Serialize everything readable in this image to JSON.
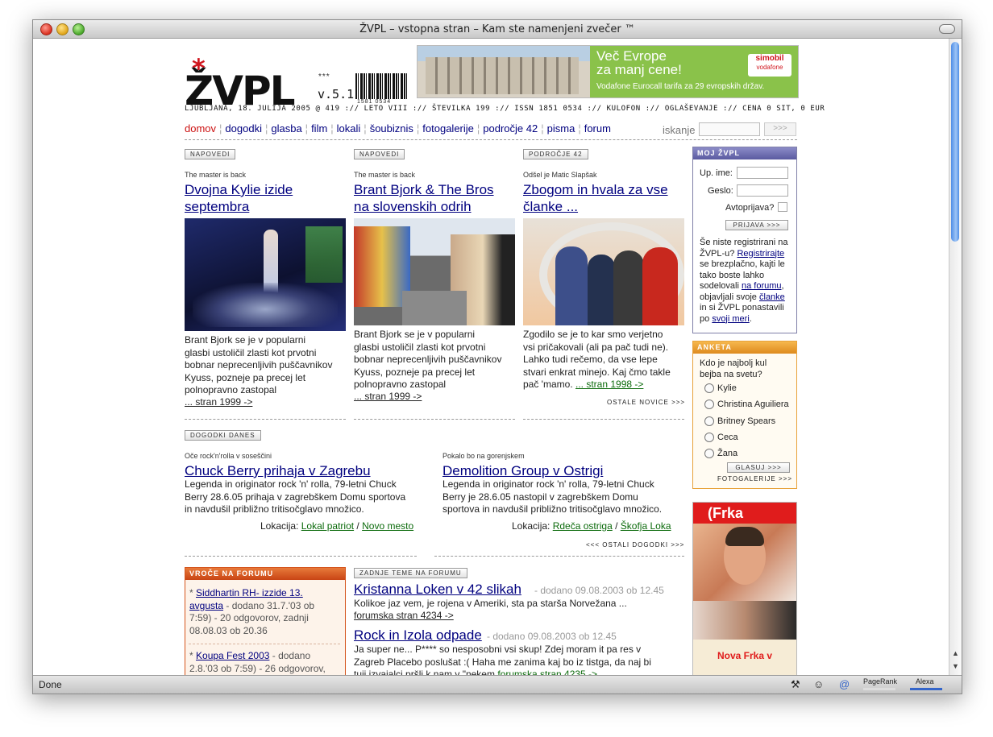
{
  "window": {
    "title": "ŽVPL – vstopna stran – Kam ste namenjeni zvečer ™"
  },
  "status": {
    "text": "Done",
    "pagerank": "PageRank",
    "alexa": "Alexa"
  },
  "header": {
    "logo": "ŽVPL",
    "stars": "***",
    "version": "v.5.1",
    "barcode_number": "1581 0534",
    "dateline": "LJUBLJANA, 18. JULIJA 2005 @ 419 :// LETO VIII :// ŠTEVILKA 199 :// ISSN 1851 0534 :// KULOFON :// OGLAŠEVANJE :// CENA 0 SIT, 0 EUR",
    "banner": {
      "line1": "Več Evrope",
      "line2": "za manj cene!",
      "line3": "Vodafone Eurocall tarifa za 29 evropskih držav.",
      "brand": "simobil",
      "brand2": "vodafone"
    }
  },
  "nav": {
    "items": [
      "domov",
      "dogodki",
      "glasba",
      "film",
      "lokali",
      "šoubiznis",
      "fotogalerije",
      "področje 42",
      "pisma",
      "forum"
    ],
    "search_label": "iskanje",
    "search_button": ">>>"
  },
  "news": [
    {
      "tag": "NAPOVEDI",
      "kicker": "The master is back",
      "title_l1": "Dvojna Kylie izide",
      "title_l2": "septembra",
      "body": [
        "Brant Bjork se je v popularni",
        "glasbi ustoličil zlasti kot prvotni",
        "bobnar neprecenljivih puščavnikov",
        "Kyuss, pozneje pa precej let",
        "polnopravno zastopal"
      ],
      "more": "... stran 1999 ->"
    },
    {
      "tag": "NAPOVEDI",
      "kicker": "The master is back",
      "title_l1": "Brant Bjork & The Bros",
      "title_l2": "na slovenskih odrih",
      "body": [
        "Brant Bjork se je v popularni",
        "glasbi ustoličil zlasti kot prvotni",
        "bobnar neprecenljivih puščavnikov",
        "Kyuss, pozneje pa precej let",
        "polnopravno zastopal"
      ],
      "more": "... stran 1999 ->"
    },
    {
      "tag": "PODROČJE 42",
      "kicker": "Odšel je Matic Slapšak",
      "title_l1": "Zbogom in hvala za vse",
      "title_l2": "članke ...",
      "body": [
        "Zgodilo se je to kar smo verjetno",
        "vsi pričakovali (ali pa pač tudi ne).",
        "Lahko tudi rečemo, da vse lepe",
        "stvari enkrat minejo. Kaj čmo takle",
        "pač 'mamo."
      ],
      "more": "... stran 1998 ->"
    }
  ],
  "ostale_novice": "OSTALE NOVICE >>>",
  "events": {
    "tag": "DOGODKI DANES",
    "items": [
      {
        "kicker": "Oče rock'n'rolla v soseščini",
        "title": "Chuck Berry prihaja v Zagrebu",
        "body": [
          "Legenda in originator rock 'n' rolla, 79-letni Chuck",
          "Berry 28.6.05 prihaja v zagrebškem Domu sportova",
          "in navdušil približno tritisočglavo množico."
        ],
        "loc_label": "Lokacija:",
        "loc1": "Lokal patriot",
        "loc2": "Novo mesto"
      },
      {
        "kicker": "Pokalo bo na gorenjskem",
        "title": "Demolition Group v Ostrigi",
        "body": [
          "Legenda in originator rock 'n' rolla, 79-letni Chuck",
          "Berry je 28.6.05 nastopil v zagrebškem Domu",
          "sportova in navdušil približno tritisočglavo množico."
        ],
        "loc_label": "Lokacija:",
        "loc1": "Rdeča ostriga",
        "loc2": "Škofja Loka"
      }
    ],
    "more": "<<< OSTALI DOGODKI >>>"
  },
  "hot_forum": {
    "title": "VROČE NA FORUMU",
    "items": [
      {
        "link1": "Siddhartin RH- izzide 13.",
        "link2": "avgusta",
        "meta": [
          " - dodano 31.7.'03 ob",
          "7:59) - 20 odgovorov, zadnji",
          "08.08.03 ob 20.36"
        ]
      },
      {
        "link1": "Koupa Fest 2003",
        "link2": "",
        "meta": [
          " - dodano",
          "2.8.'03 ob 7:59) - 26 odgovorov,"
        ]
      }
    ]
  },
  "latest_forum": {
    "tag": "ZADNJE TEME NA FORUMU",
    "items": [
      {
        "title": "Kristanna Loken v 42 slikah",
        "meta": " - dodano 09.08.2003 ob 12.45",
        "body": [
          "Kolikoe jaz vem, je rojena v Ameriki, sta pa starša Norvežana ..."
        ],
        "link": "forumska stran 4234 ->"
      },
      {
        "title": "Rock in Izola odpade",
        "meta": " - dodano 09.08.2003 ob 12.45",
        "body": [
          "Ja super ne... P**** so nesposobni vsi skup! Zdej moram it pa res v",
          "Zagreb Placebo poslušat :( Haha me zanima kaj bo iz tistga, da naj bi",
          "tuji izvajalci pršli k nam v \"nekem"
        ],
        "link": "forumska stran 4235 ->"
      }
    ]
  },
  "moj": {
    "title": "MOJ ŽVPL",
    "user_label": "Up. ime:",
    "pass_label": "Geslo:",
    "auto_label": "Avtoprijava?",
    "login_button": "PRIJAVA >>>",
    "text": [
      "Še niste registrirani na",
      "ŽVPL-u?",
      "Registrirajte",
      "se brezplačno, kajti le",
      "tako boste lahko",
      "sodelovali",
      "na forumu",
      "objavljali svoje",
      "članke",
      "in si ŽVPL ponastavili",
      "po",
      "svoji meri"
    ]
  },
  "poll": {
    "title": "ANKETA",
    "question_l1": "Kdo je najbolj kul",
    "question_l2": "bejba na svetu?",
    "options": [
      "Kylie",
      "Christina Aguiliera",
      "Britney Spears",
      "Ceca",
      "Žana"
    ],
    "vote_button": "GLASUJ >>>",
    "galleries": "FOTOGALERIJE >>>"
  },
  "frka": {
    "title": "(Frka",
    "promo": "Nova Frka v"
  },
  "colors": {
    "link": "#00007f",
    "nav_current": "#cc1111",
    "green_link": "#0b6a0b",
    "moj_header": "#6f6fb0",
    "poll_header": "#e8a23a",
    "forum_header": "#d4541c"
  }
}
